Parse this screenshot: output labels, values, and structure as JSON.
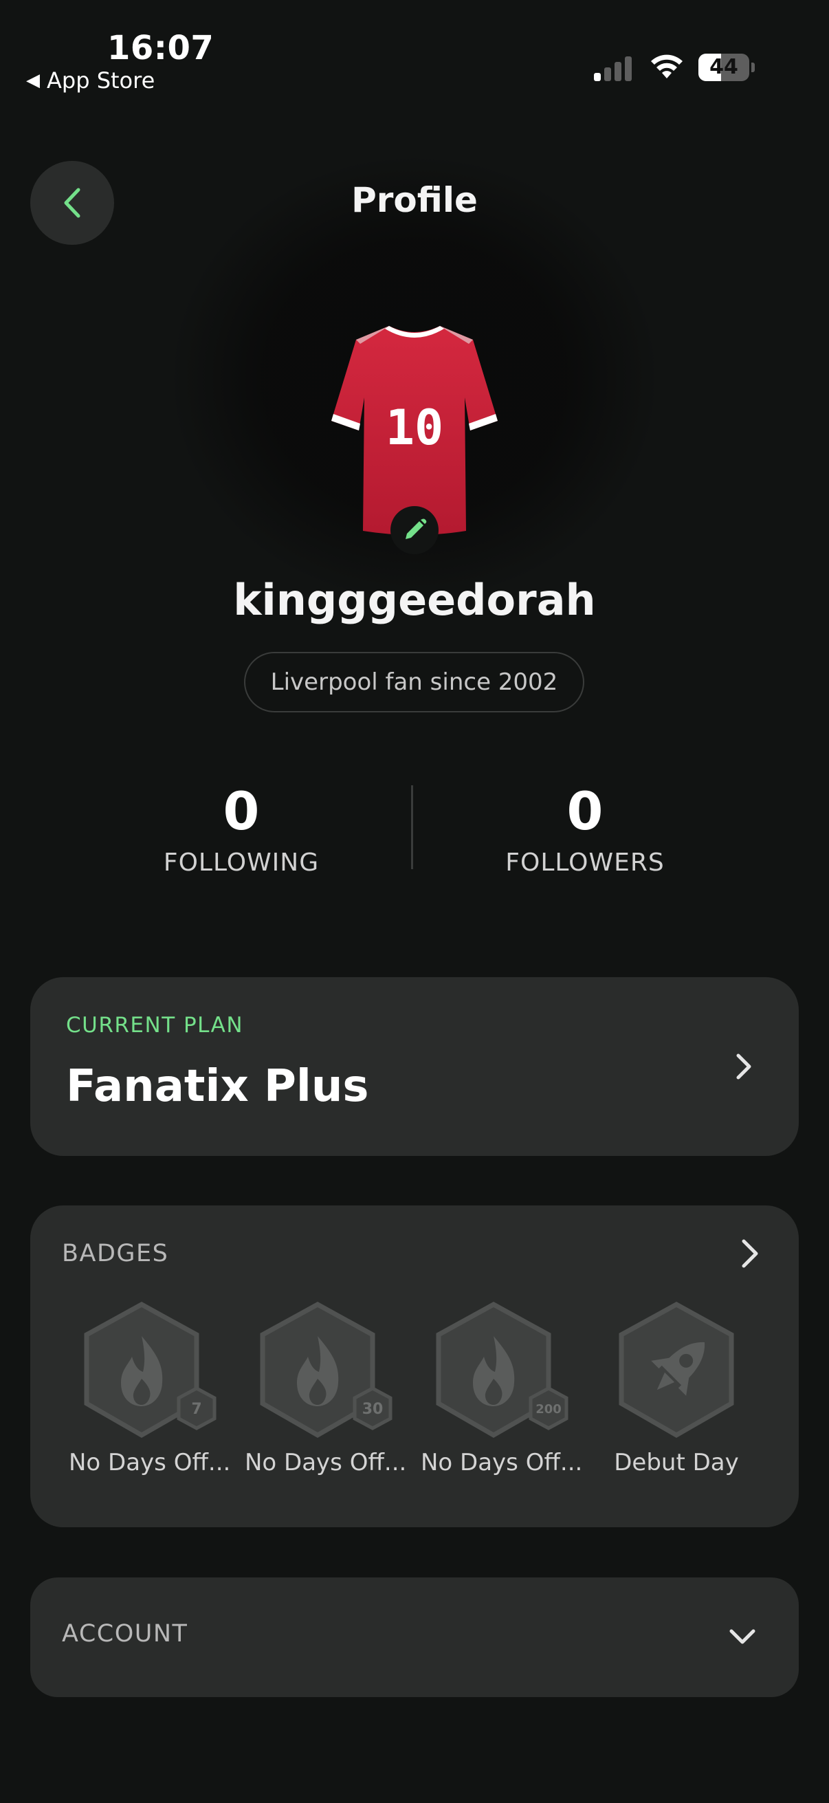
{
  "status_bar": {
    "time": "16:07",
    "back_app": "App Store",
    "back_icon": "back-triangle-icon",
    "battery_level": "44",
    "battery_fraction": 0.44
  },
  "header": {
    "title": "Profile",
    "back_icon": "chevron-left-icon",
    "accent_color": "#74e08a"
  },
  "profile": {
    "avatar": {
      "jersey_number": "10",
      "jersey_color": "#c8213a",
      "edit_icon": "pencil-icon"
    },
    "username": "kingggeedorah",
    "bio": "Liverpool fan since 2002"
  },
  "stats": {
    "following": {
      "value": "0",
      "label": "FOLLOWING"
    },
    "followers": {
      "value": "0",
      "label": "FOLLOWERS"
    }
  },
  "plan": {
    "label": "CURRENT PLAN",
    "name": "Fanatix Plus",
    "icon": "chevron-right-icon"
  },
  "badges": {
    "title": "BADGES",
    "icon": "chevron-right-icon",
    "items": [
      {
        "label": "No Days Off...",
        "icon": "flame-icon",
        "count": "7"
      },
      {
        "label": "No Days Off...",
        "icon": "flame-icon",
        "count": "30"
      },
      {
        "label": "No Days Off...",
        "icon": "flame-icon",
        "count": "200"
      },
      {
        "label": "Debut Day",
        "icon": "rocket-icon",
        "count": ""
      }
    ]
  },
  "account": {
    "title": "ACCOUNT",
    "icon": "chevron-down-icon"
  }
}
